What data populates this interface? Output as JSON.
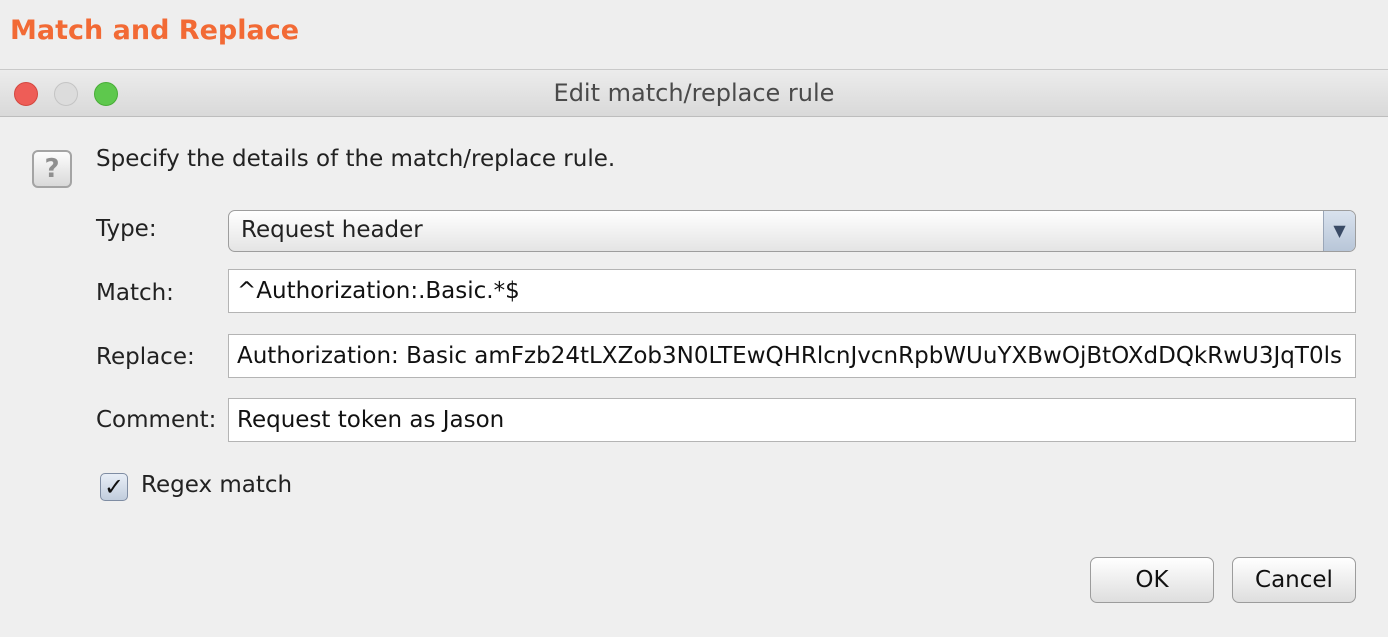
{
  "app": {
    "heading": "Match and Replace",
    "accent_color": "#f26a35"
  },
  "dialog": {
    "title": "Edit match/replace rule",
    "window_controls": [
      "close-icon",
      "minimize-icon",
      "maximize-icon"
    ],
    "help_icon": "question-mark-icon",
    "help_glyph": "?",
    "instructions": "Specify the details of the match/replace rule."
  },
  "form": {
    "type_label": "Type:",
    "type_value": "Request header",
    "match_label": "Match:",
    "match_value": "^Authorization:.Basic.*$",
    "replace_label": "Replace:",
    "replace_value": "Authorization: Basic amFzb24tLXZob3N0LTEwQHRlcnJvcnRpbWUuYXBwOjBtOXdDQkRwU3JqT0ls",
    "comment_label": "Comment:",
    "comment_value": "Request token as Jason",
    "regex_label": "Regex match",
    "regex_checked": true,
    "check_glyph": "✓"
  },
  "buttons": {
    "ok": "OK",
    "cancel": "Cancel"
  }
}
